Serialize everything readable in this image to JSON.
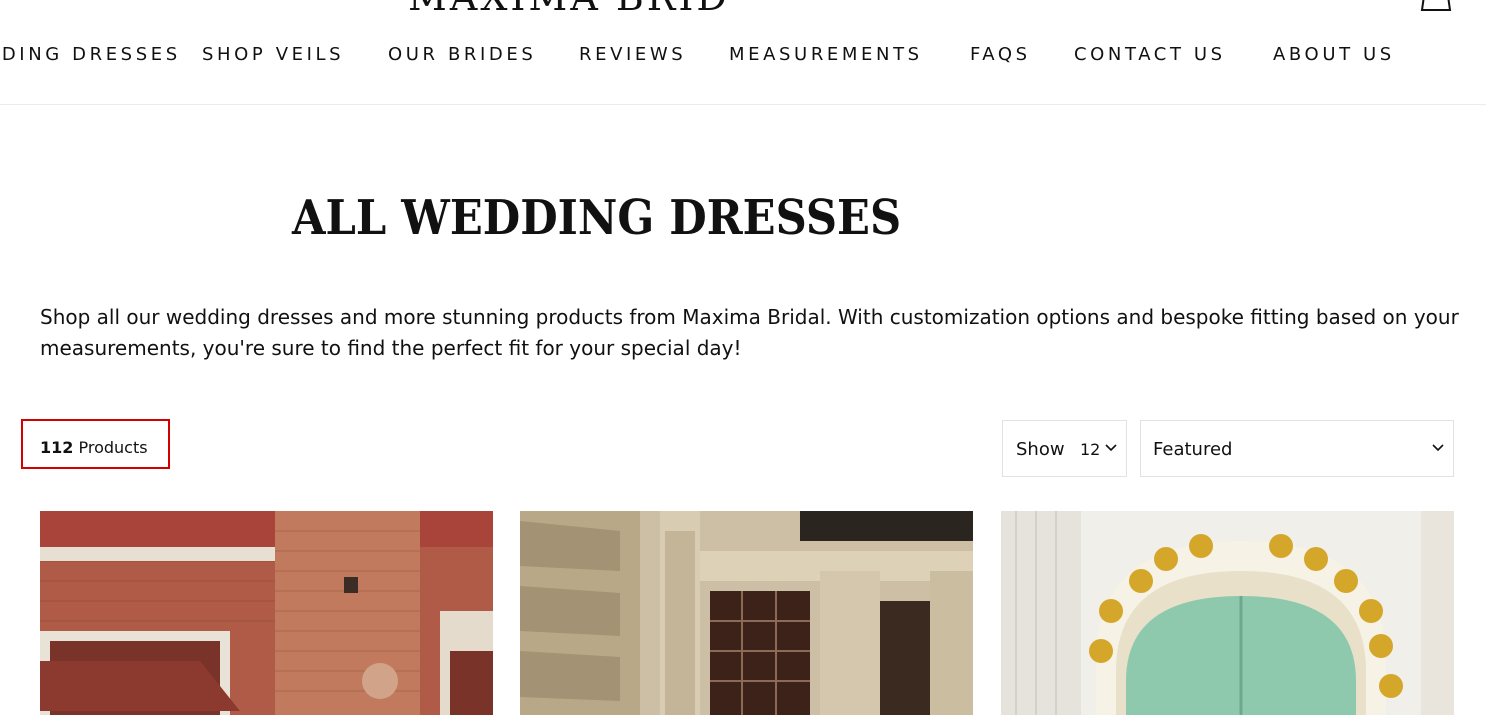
{
  "brand": {
    "logo_text": "MAXIMA BRIDAL"
  },
  "nav": {
    "items": [
      {
        "label": "WEDDING DRESSES"
      },
      {
        "label": "SHOP VEILS"
      },
      {
        "label": "OUR BRIDES"
      },
      {
        "label": "REVIEWS"
      },
      {
        "label": "MEASUREMENTS"
      },
      {
        "label": "FAQS"
      },
      {
        "label": "CONTACT US"
      },
      {
        "label": "ABOUT US"
      }
    ]
  },
  "icons": {
    "cart": "cart-icon",
    "chevron": "chevron-down-icon"
  },
  "page": {
    "title": "ALL WEDDING DRESSES",
    "description": "Shop all our wedding dresses and more stunning products from Maxima Bridal. With customization options and bespoke fitting based on your measurements, you're sure to find the perfect fit for your special day!"
  },
  "toolbar": {
    "count_value": "112",
    "count_label": "Products",
    "show_label": "Show",
    "show_value": "12",
    "sort_value": "Featured"
  },
  "colors": {
    "highlight_border": "#d40000",
    "text": "#111111",
    "select_border": "#e2e2e2"
  }
}
